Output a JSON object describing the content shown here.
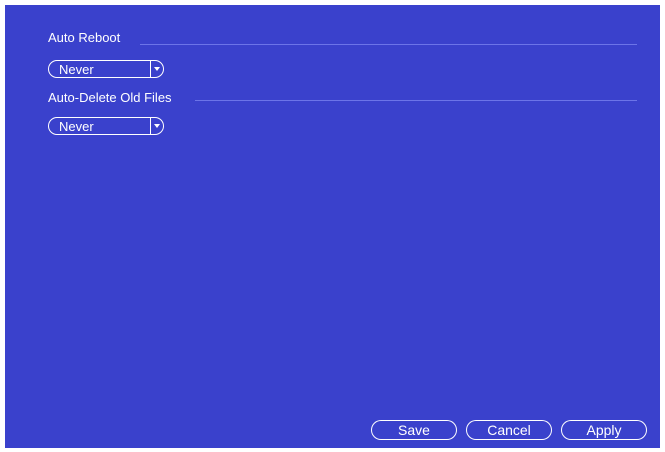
{
  "settings": {
    "auto_reboot": {
      "label": "Auto Reboot",
      "value": "Never"
    },
    "auto_delete": {
      "label": "Auto-Delete Old Files",
      "value": "Never"
    }
  },
  "footer": {
    "save_label": "Save",
    "cancel_label": "Cancel",
    "apply_label": "Apply"
  },
  "colors": {
    "panel_background": "#3a41cc",
    "text": "#ffffff",
    "section_line": "#6c74e8"
  },
  "icons": {
    "dropdown": "chevron-down-icon"
  }
}
